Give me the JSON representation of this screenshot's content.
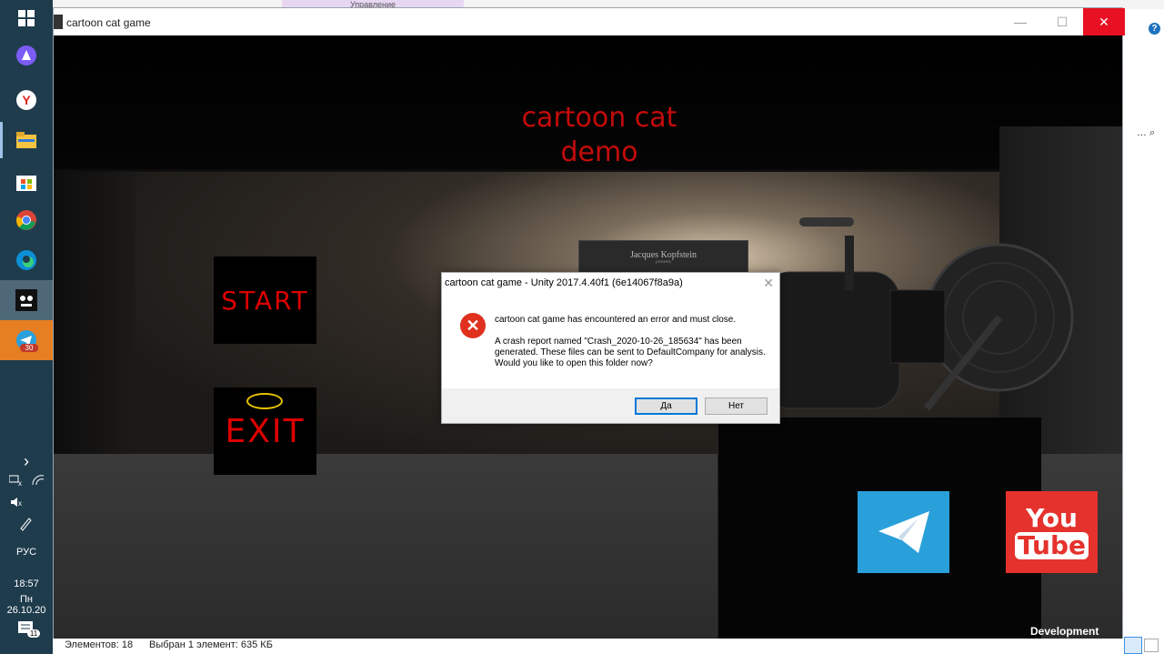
{
  "taskbar": {
    "expand_arrow": "›",
    "language": "РУС",
    "time": "18:57",
    "date": "Пн 26.10.20",
    "notifications_count": "11",
    "telegram_badge": "30"
  },
  "explorer": {
    "tab_label": "Управление",
    "status_items": "Элементов: 18",
    "status_selected": "Выбран 1 элемент: 635 КБ",
    "help_symbol": "?",
    "search_symbol": "… ⌕"
  },
  "game_window": {
    "title": "cartoon cat game",
    "minimize": "—",
    "maximize": "☐",
    "close": "✕"
  },
  "game": {
    "title_line1": "cartoon cat",
    "title_line2": "demo",
    "poster_text": "Jacques Kopfstein",
    "poster_sub": "presents",
    "start_label": "START",
    "exit_label": "EXIT",
    "youtube_top": "You",
    "youtube_bottom": "Tube",
    "dev_build": "Development Build"
  },
  "dialog": {
    "title": "cartoon cat game - Unity 2017.4.40f1 (6e14067f8a9a)",
    "close": "✕",
    "message1": "cartoon cat game has encountered an error and must close.",
    "message2": "A crash report named \"Crash_2020-10-26_185634\" has been generated. These files can be sent to DefaultCompany for analysis. Would you like to open this folder now?",
    "yes_label": "Да",
    "no_label": "Нет"
  },
  "colors": {
    "taskbar": "#1f3c4d",
    "title_red": "#c40b0b",
    "close_red": "#e81123",
    "telegram": "#2aa0db",
    "youtube": "#e5322d"
  }
}
